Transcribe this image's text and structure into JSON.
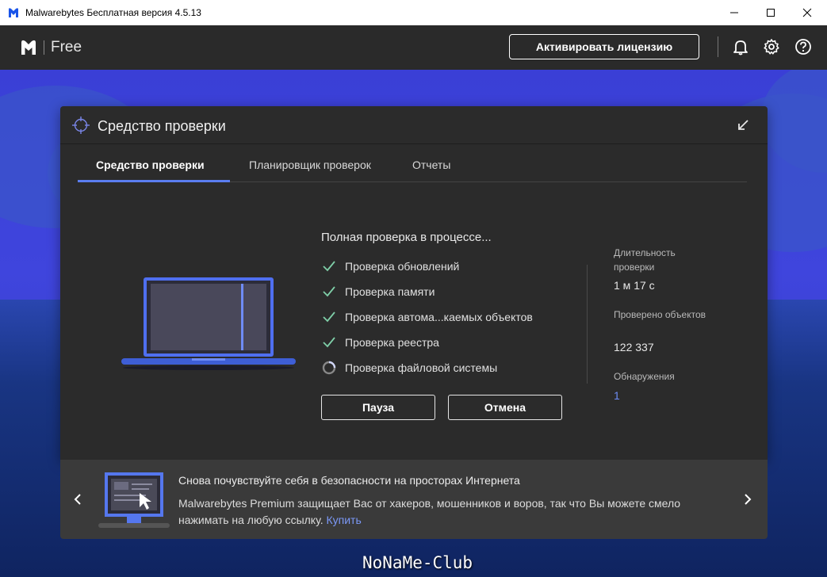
{
  "window": {
    "title": "Malwarebytes Бесплатная версия  4.5.13",
    "app_icon": "malwarebytes-logo-icon"
  },
  "header": {
    "product": "Free",
    "activate_label": "Активировать лицензию",
    "icons": [
      "bell-icon",
      "gear-icon",
      "help-icon"
    ]
  },
  "panel": {
    "title": "Средство проверки",
    "tabs": [
      {
        "label": "Средство проверки",
        "active": true
      },
      {
        "label": "Планировщик проверок",
        "active": false
      },
      {
        "label": "Отчеты",
        "active": false
      }
    ]
  },
  "scan": {
    "title": "Полная проверка в процессе...",
    "steps": [
      {
        "label": "Проверка обновлений",
        "status": "done"
      },
      {
        "label": "Проверка памяти",
        "status": "done"
      },
      {
        "label": "Проверка автома...каемых объектов",
        "status": "done"
      },
      {
        "label": "Проверка реестра",
        "status": "done"
      },
      {
        "label": "Проверка файловой системы",
        "status": "in-progress"
      }
    ],
    "pause_label": "Пауза",
    "cancel_label": "Отмена"
  },
  "stats": {
    "duration_label": "Длительность проверки",
    "duration_value": "1 м 17 с",
    "scanned_label": "Проверено объектов",
    "scanned_value": "122 337",
    "detections_label": "Обнаружения",
    "detections_value": "1"
  },
  "promo": {
    "title": "Снова почувствуйте себя в безопасности на просторах Интернета",
    "text": "Malwarebytes Premium защищает Вас от хакеров, мошенников и воров, так что Вы можете смело нажимать на любую ссылку.",
    "link_label": "Купить"
  },
  "watermark": "NoNaMe-Club",
  "colors": {
    "accent": "#5b7df0",
    "link": "#6d8cf5",
    "check": "#7fcfa8",
    "panel": "#2b2b2b",
    "header": "#2a2a2a"
  }
}
